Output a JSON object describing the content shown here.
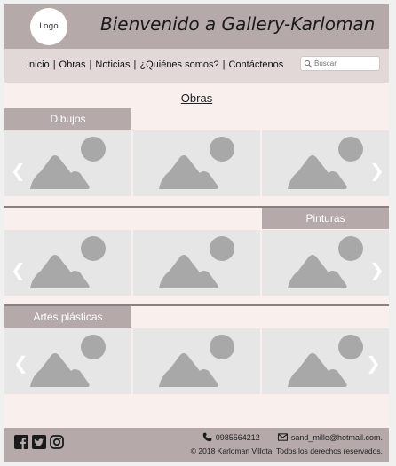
{
  "header": {
    "logo_text": "Logo",
    "title": "Bienvenido a Gallery-Karloman"
  },
  "nav": {
    "items": [
      "Inicio",
      "Obras",
      "Noticias",
      "¿Quiénes somos?",
      "Contáctenos"
    ],
    "search_placeholder": "Buscar"
  },
  "main": {
    "heading": "Obras",
    "sections": [
      {
        "label": "Dibujos",
        "label_align": "left"
      },
      {
        "label": "Pinturas",
        "label_align": "right"
      },
      {
        "label": "Artes plásticas",
        "label_align": "left"
      }
    ],
    "prev_icon": "chevron-left-icon",
    "next_icon": "chevron-right-icon",
    "image_icon": "image-placeholder-icon"
  },
  "footer": {
    "social_icons": [
      "facebook-icon",
      "twitter-icon",
      "instagram-icon"
    ],
    "phone": "0985564212",
    "email": "sand_mille@hotmail.com.",
    "copyright": "© 2018 Karloman Villota. Todos los derechos reservados."
  },
  "colors": {
    "header_bg": "#b5a9a9",
    "nav_bg": "#e3d8d8",
    "page_bg": "#f9efed",
    "tile_bg": "#e6e6e6",
    "placeholder_gray": "#a8a8a8"
  }
}
